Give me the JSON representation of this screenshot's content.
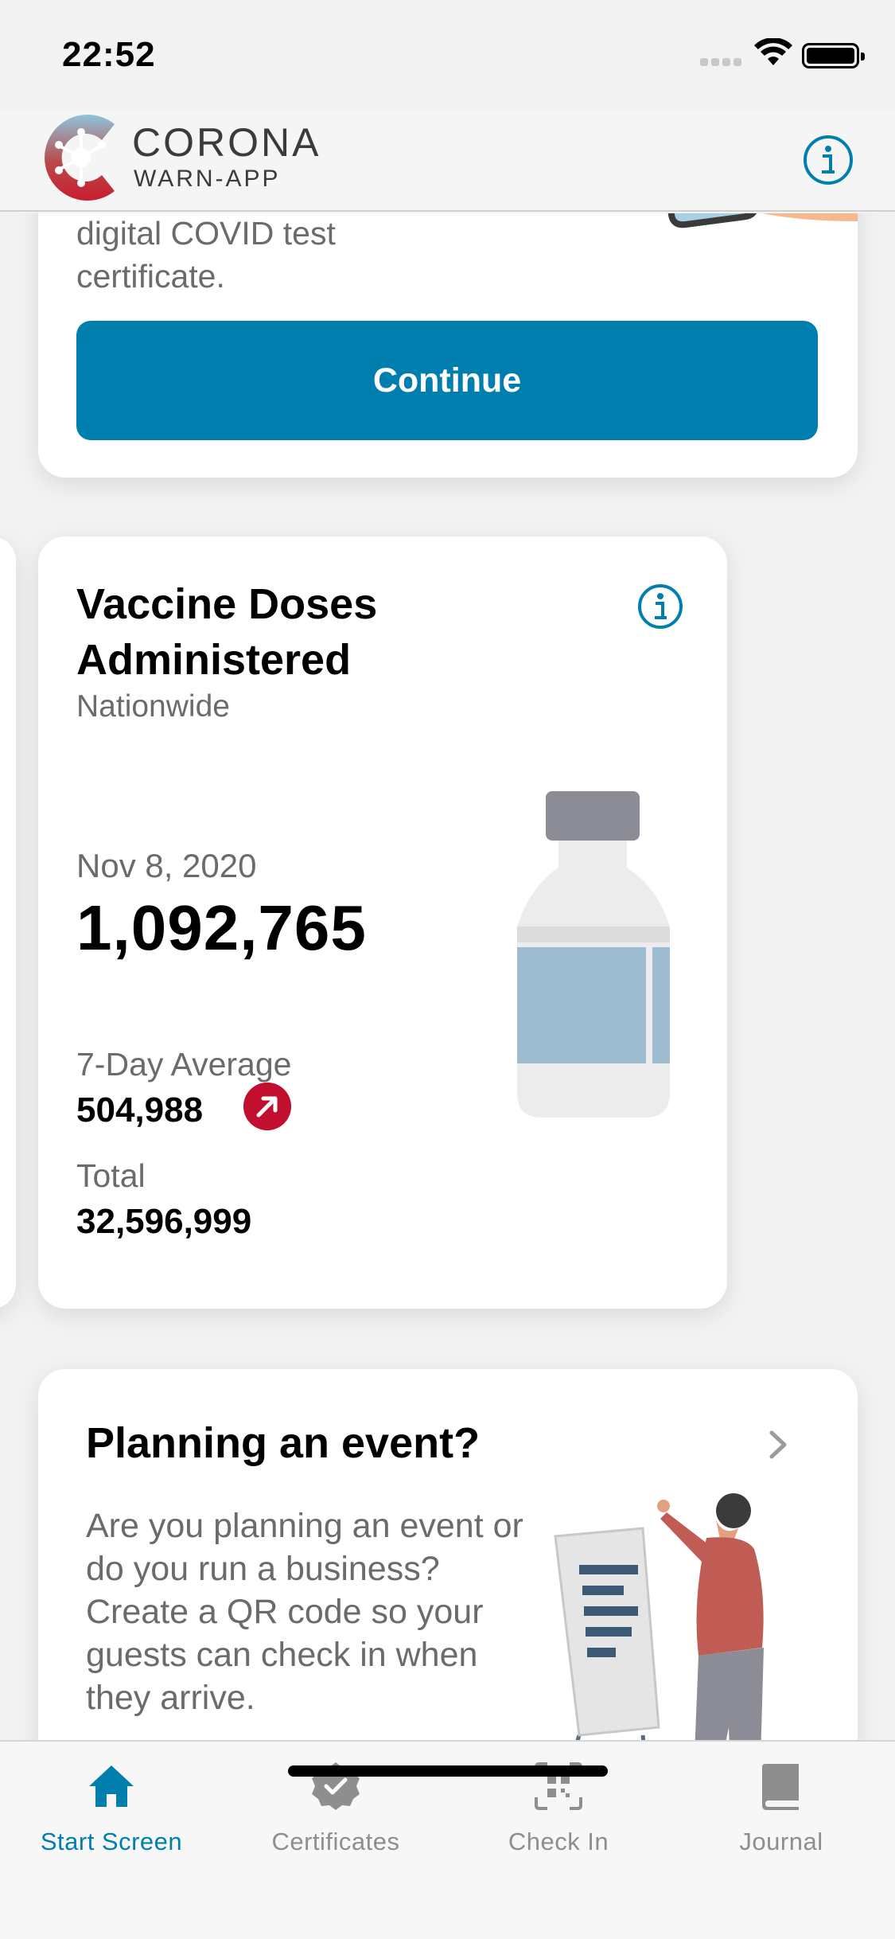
{
  "status_bar": {
    "time": "22:52"
  },
  "header": {
    "app_name_line1": "CORONA",
    "app_name_line2": "WARN-APP",
    "info_icon": "info-icon"
  },
  "top_card": {
    "text_line1": "digital COVID test",
    "text_line2": "certificate.",
    "continue_label": "Continue"
  },
  "vaccine_card": {
    "title": "Vaccine Doses Administered",
    "subtitle": "Nationwide",
    "date": "Nov 8, 2020",
    "value": "1,092,765",
    "avg_label": "7-Day Average",
    "avg_value": "504,988",
    "trend": "up",
    "total_label": "Total",
    "total_value": "32,596,999"
  },
  "event_card": {
    "title": "Planning an event?",
    "text": "Are you planning an event or do you run a business? Create a QR code so your guests can check in when they arrive."
  },
  "tabbar": {
    "tabs": [
      {
        "label": "Start Screen",
        "icon": "home-icon",
        "active": true
      },
      {
        "label": "Certificates",
        "icon": "certificate-icon",
        "active": false
      },
      {
        "label": "Check In",
        "icon": "qr-scan-icon",
        "active": false
      },
      {
        "label": "Journal",
        "icon": "journal-icon",
        "active": false
      }
    ]
  },
  "colors": {
    "accent": "#007faf",
    "trend_up": "#c20f2f",
    "muted_text": "#6b6b6b"
  }
}
